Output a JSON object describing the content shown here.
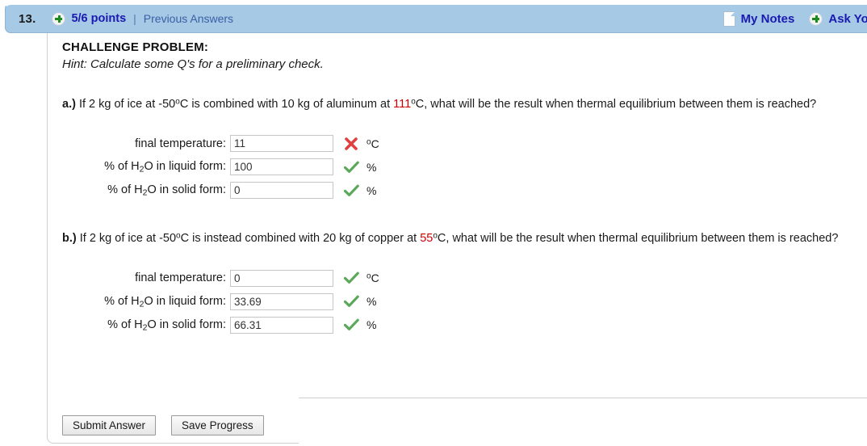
{
  "header": {
    "question_number": "13.",
    "points": "5/6 points",
    "separator": "|",
    "previous_answers": "Previous Answers",
    "my_notes": "My Notes",
    "ask_your_teacher": "Ask You",
    "plus_icon": "plus-circle-icon",
    "notes_icon": "page-icon",
    "bg_color": "#a6c9e6",
    "link_color": "#1a1ab0"
  },
  "problem": {
    "title": "CHALLENGE PROBLEM:",
    "hint": "Hint: Calculate some Q's for a preliminary check."
  },
  "parts": [
    {
      "label": "a.)",
      "text_before_red": " If 2 kg of ice at -50ºC is combined with 10 kg of aluminum at ",
      "red_value": "111",
      "text_after_red": "ºC, what will be the result when thermal equilibrium between them is reached?",
      "fields": [
        {
          "label": "final temperature:",
          "value": "11",
          "status": "incorrect",
          "unit": "ºC",
          "input_width": 128
        },
        {
          "label": "% of H2O in liquid form:",
          "value": "100",
          "status": "correct",
          "unit": "%",
          "input_width": 128
        },
        {
          "label": "% of H2O in solid form:",
          "value": "0",
          "status": "correct",
          "unit": "%",
          "input_width": 128
        }
      ]
    },
    {
      "label": "b.)",
      "text_before_red": " If 2 kg of ice at -50ºC is instead combined with 20 kg of copper at ",
      "red_value": "55",
      "text_after_red": "ºC, what will be the result when thermal equilibrium between them is reached?",
      "fields": [
        {
          "label": "final temperature:",
          "value": "0",
          "status": "correct",
          "unit": "ºC",
          "input_width": 128
        },
        {
          "label": "% of H2O in liquid form:",
          "value": "33.69",
          "status": "correct",
          "unit": "%",
          "input_width": 128
        },
        {
          "label": "% of H2O in solid form:",
          "value": "66.31",
          "status": "correct",
          "unit": "%",
          "input_width": 128
        }
      ]
    }
  ],
  "buttons": {
    "submit": "Submit Answer",
    "save": "Save Progress"
  },
  "colors": {
    "correct": "#5ba85b",
    "incorrect": "#e04040",
    "red_text": "#cc0000"
  }
}
